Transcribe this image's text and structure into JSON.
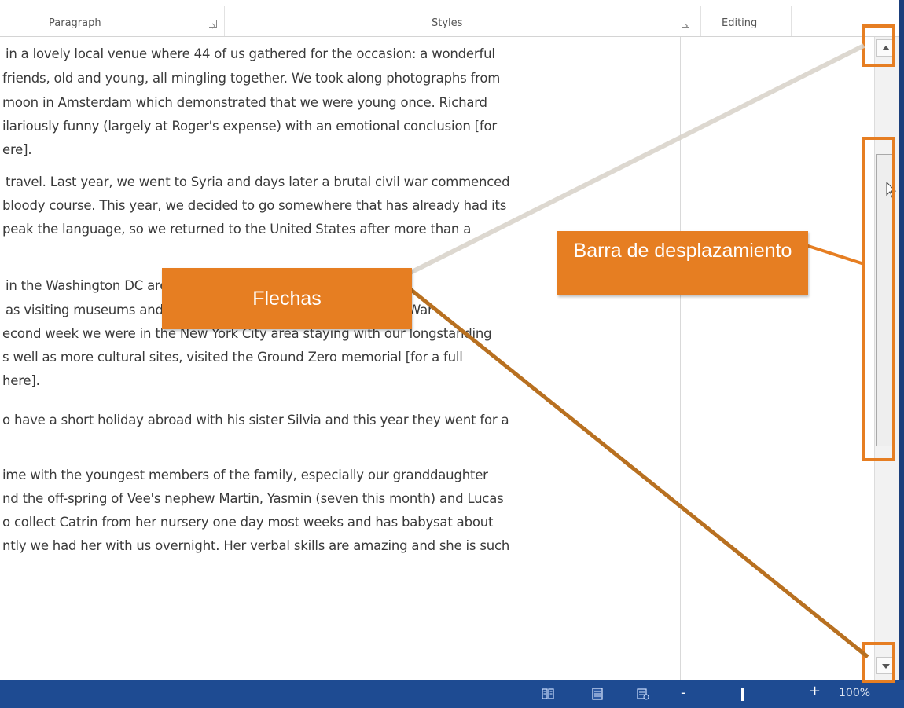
{
  "ribbon": {
    "groups": [
      "Paragraph",
      "Styles",
      "Editing"
    ]
  },
  "document": {
    "lines": [
      "in a lovely local venue where 44 of us gathered for the occasion: a wonderful",
      "friends, old and young, all mingling together. We took along photographs from",
      "moon in Amsterdam which demonstrated that we were young once. Richard",
      "ilariously funny (largely at Roger's expense) with an emotional conclusion [for",
      "ere].",
      "travel. Last year, we went to Syria and days later a brutal civil war commenced",
      "bloody course. This year, we decided to go somewhere that has already had its",
      "peak the language, so we returned to the United States after more than a",
      "in the Washington DC area staying with our good friends Mike &",
      "as visiting museums and memorials, visited the American Civil War",
      "econd week we were in the New York City area staying with our longstanding",
      "s well as more cultural sites, visited the Ground Zero memorial [for a full",
      "here].",
      "o have a short holiday abroad with his sister Silvia and this year they went for a",
      "ime with the youngest members of the family, especially our granddaughter",
      "nd the off-spring of Vee's nephew Martin, Yasmin (seven this month) and Lucas",
      "o collect Catrin from her nursery one day most weeks and has babysat about",
      "ntly we had her with us overnight. Her verbal skills are amazing and she is such"
    ]
  },
  "scrollbar": {
    "up_icon": "arrow-up-icon",
    "down_icon": "arrow-down-icon"
  },
  "statusbar": {
    "zoom_minus": "-",
    "zoom_plus": "+",
    "zoom_percent": "100%",
    "zoom_level": 1.0,
    "view_icons": [
      "read-mode-icon",
      "print-layout-icon",
      "web-layout-icon"
    ]
  },
  "callouts": {
    "arrows_label": "Flechas",
    "scrollbar_label": "Barra de desplazamiento"
  },
  "colors": {
    "accent": "#e67e22",
    "statusbar": "#1e4b92",
    "text": "#3a3a3a"
  }
}
